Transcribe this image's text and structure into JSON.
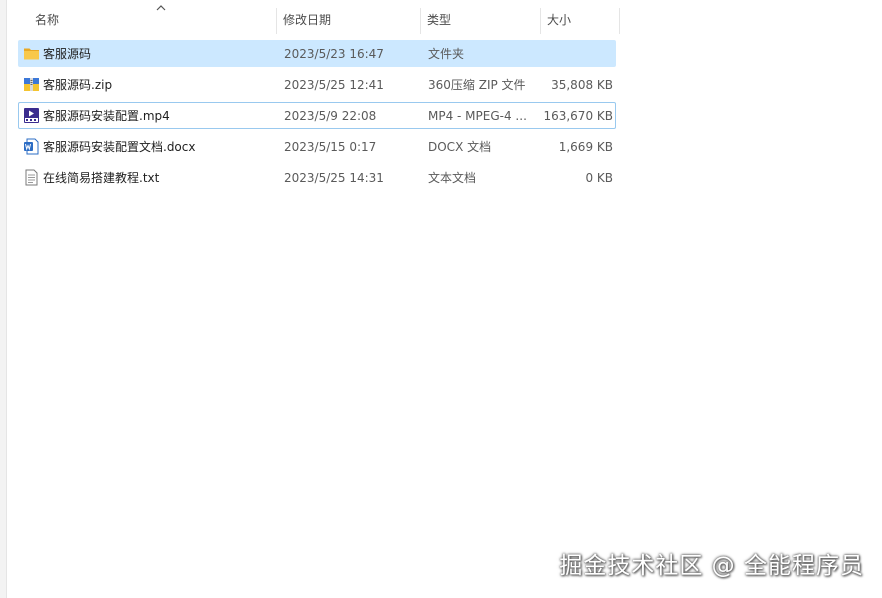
{
  "columns": {
    "name": "名称",
    "modified": "修改日期",
    "type": "类型",
    "size": "大小"
  },
  "sort": {
    "column": "name",
    "direction": "ascending"
  },
  "files": [
    {
      "name": "客服源码",
      "modified": "2023/5/23 16:47",
      "type": "文件夹",
      "size": "",
      "icon": "folder-icon",
      "state": "selected"
    },
    {
      "name": "客服源码.zip",
      "modified": "2023/5/25 12:41",
      "type": "360压缩 ZIP 文件",
      "size": "35,808 KB",
      "icon": "zip-archive-icon",
      "state": ""
    },
    {
      "name": "客服源码安装配置.mp4",
      "modified": "2023/5/9 22:08",
      "type": "MP4 - MPEG-4 ...",
      "size": "163,670 KB",
      "icon": "video-file-icon",
      "state": "hover"
    },
    {
      "name": "客服源码安装配置文档.docx",
      "modified": "2023/5/15 0:17",
      "type": "DOCX 文档",
      "size": "1,669 KB",
      "icon": "word-document-icon",
      "state": ""
    },
    {
      "name": "在线简易搭建教程.txt",
      "modified": "2023/5/25 14:31",
      "type": "文本文档",
      "size": "0 KB",
      "icon": "text-file-icon",
      "state": ""
    }
  ],
  "watermark": "掘金技术社区 @ 全能程序员",
  "colors": {
    "selection": "#cce8ff",
    "hover_border": "#99c9ef",
    "folder": "#f8c84a"
  }
}
